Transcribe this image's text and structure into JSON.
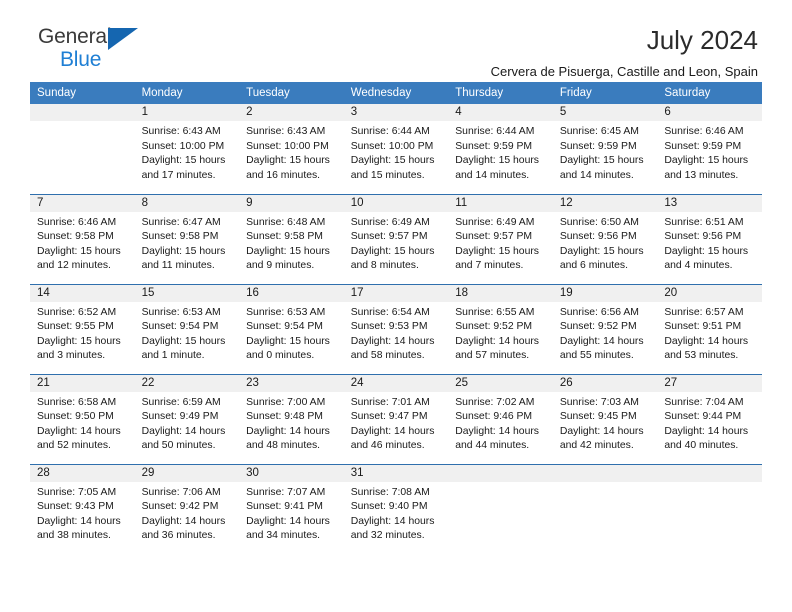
{
  "logo": {
    "word_one": "General",
    "word_two": "Blue",
    "accent_color": "#1f7fd4",
    "triangle_color": "#1566b0",
    "triangle_icon": "triangle-icon"
  },
  "header": {
    "title": "July 2024",
    "location": "Cervera de Pisuerga, Castille and Leon, Spain"
  },
  "theme": {
    "header_band": "#3a7cbe",
    "daynum_band": "#f0f0f0",
    "row_divider": "#2f6fad"
  },
  "weekdays": [
    "Sunday",
    "Monday",
    "Tuesday",
    "Wednesday",
    "Thursday",
    "Friday",
    "Saturday"
  ],
  "weeks": [
    [
      {
        "day": "",
        "sunrise": "",
        "sunset": "",
        "daylight_a": "",
        "daylight_b": ""
      },
      {
        "day": "1",
        "sunrise": "Sunrise: 6:43 AM",
        "sunset": "Sunset: 10:00 PM",
        "daylight_a": "Daylight: 15 hours",
        "daylight_b": "and 17 minutes."
      },
      {
        "day": "2",
        "sunrise": "Sunrise: 6:43 AM",
        "sunset": "Sunset: 10:00 PM",
        "daylight_a": "Daylight: 15 hours",
        "daylight_b": "and 16 minutes."
      },
      {
        "day": "3",
        "sunrise": "Sunrise: 6:44 AM",
        "sunset": "Sunset: 10:00 PM",
        "daylight_a": "Daylight: 15 hours",
        "daylight_b": "and 15 minutes."
      },
      {
        "day": "4",
        "sunrise": "Sunrise: 6:44 AM",
        "sunset": "Sunset: 9:59 PM",
        "daylight_a": "Daylight: 15 hours",
        "daylight_b": "and 14 minutes."
      },
      {
        "day": "5",
        "sunrise": "Sunrise: 6:45 AM",
        "sunset": "Sunset: 9:59 PM",
        "daylight_a": "Daylight: 15 hours",
        "daylight_b": "and 14 minutes."
      },
      {
        "day": "6",
        "sunrise": "Sunrise: 6:46 AM",
        "sunset": "Sunset: 9:59 PM",
        "daylight_a": "Daylight: 15 hours",
        "daylight_b": "and 13 minutes."
      }
    ],
    [
      {
        "day": "7",
        "sunrise": "Sunrise: 6:46 AM",
        "sunset": "Sunset: 9:58 PM",
        "daylight_a": "Daylight: 15 hours",
        "daylight_b": "and 12 minutes."
      },
      {
        "day": "8",
        "sunrise": "Sunrise: 6:47 AM",
        "sunset": "Sunset: 9:58 PM",
        "daylight_a": "Daylight: 15 hours",
        "daylight_b": "and 11 minutes."
      },
      {
        "day": "9",
        "sunrise": "Sunrise: 6:48 AM",
        "sunset": "Sunset: 9:58 PM",
        "daylight_a": "Daylight: 15 hours",
        "daylight_b": "and 9 minutes."
      },
      {
        "day": "10",
        "sunrise": "Sunrise: 6:49 AM",
        "sunset": "Sunset: 9:57 PM",
        "daylight_a": "Daylight: 15 hours",
        "daylight_b": "and 8 minutes."
      },
      {
        "day": "11",
        "sunrise": "Sunrise: 6:49 AM",
        "sunset": "Sunset: 9:57 PM",
        "daylight_a": "Daylight: 15 hours",
        "daylight_b": "and 7 minutes."
      },
      {
        "day": "12",
        "sunrise": "Sunrise: 6:50 AM",
        "sunset": "Sunset: 9:56 PM",
        "daylight_a": "Daylight: 15 hours",
        "daylight_b": "and 6 minutes."
      },
      {
        "day": "13",
        "sunrise": "Sunrise: 6:51 AM",
        "sunset": "Sunset: 9:56 PM",
        "daylight_a": "Daylight: 15 hours",
        "daylight_b": "and 4 minutes."
      }
    ],
    [
      {
        "day": "14",
        "sunrise": "Sunrise: 6:52 AM",
        "sunset": "Sunset: 9:55 PM",
        "daylight_a": "Daylight: 15 hours",
        "daylight_b": "and 3 minutes."
      },
      {
        "day": "15",
        "sunrise": "Sunrise: 6:53 AM",
        "sunset": "Sunset: 9:54 PM",
        "daylight_a": "Daylight: 15 hours",
        "daylight_b": "and 1 minute."
      },
      {
        "day": "16",
        "sunrise": "Sunrise: 6:53 AM",
        "sunset": "Sunset: 9:54 PM",
        "daylight_a": "Daylight: 15 hours",
        "daylight_b": "and 0 minutes."
      },
      {
        "day": "17",
        "sunrise": "Sunrise: 6:54 AM",
        "sunset": "Sunset: 9:53 PM",
        "daylight_a": "Daylight: 14 hours",
        "daylight_b": "and 58 minutes."
      },
      {
        "day": "18",
        "sunrise": "Sunrise: 6:55 AM",
        "sunset": "Sunset: 9:52 PM",
        "daylight_a": "Daylight: 14 hours",
        "daylight_b": "and 57 minutes."
      },
      {
        "day": "19",
        "sunrise": "Sunrise: 6:56 AM",
        "sunset": "Sunset: 9:52 PM",
        "daylight_a": "Daylight: 14 hours",
        "daylight_b": "and 55 minutes."
      },
      {
        "day": "20",
        "sunrise": "Sunrise: 6:57 AM",
        "sunset": "Sunset: 9:51 PM",
        "daylight_a": "Daylight: 14 hours",
        "daylight_b": "and 53 minutes."
      }
    ],
    [
      {
        "day": "21",
        "sunrise": "Sunrise: 6:58 AM",
        "sunset": "Sunset: 9:50 PM",
        "daylight_a": "Daylight: 14 hours",
        "daylight_b": "and 52 minutes."
      },
      {
        "day": "22",
        "sunrise": "Sunrise: 6:59 AM",
        "sunset": "Sunset: 9:49 PM",
        "daylight_a": "Daylight: 14 hours",
        "daylight_b": "and 50 minutes."
      },
      {
        "day": "23",
        "sunrise": "Sunrise: 7:00 AM",
        "sunset": "Sunset: 9:48 PM",
        "daylight_a": "Daylight: 14 hours",
        "daylight_b": "and 48 minutes."
      },
      {
        "day": "24",
        "sunrise": "Sunrise: 7:01 AM",
        "sunset": "Sunset: 9:47 PM",
        "daylight_a": "Daylight: 14 hours",
        "daylight_b": "and 46 minutes."
      },
      {
        "day": "25",
        "sunrise": "Sunrise: 7:02 AM",
        "sunset": "Sunset: 9:46 PM",
        "daylight_a": "Daylight: 14 hours",
        "daylight_b": "and 44 minutes."
      },
      {
        "day": "26",
        "sunrise": "Sunrise: 7:03 AM",
        "sunset": "Sunset: 9:45 PM",
        "daylight_a": "Daylight: 14 hours",
        "daylight_b": "and 42 minutes."
      },
      {
        "day": "27",
        "sunrise": "Sunrise: 7:04 AM",
        "sunset": "Sunset: 9:44 PM",
        "daylight_a": "Daylight: 14 hours",
        "daylight_b": "and 40 minutes."
      }
    ],
    [
      {
        "day": "28",
        "sunrise": "Sunrise: 7:05 AM",
        "sunset": "Sunset: 9:43 PM",
        "daylight_a": "Daylight: 14 hours",
        "daylight_b": "and 38 minutes."
      },
      {
        "day": "29",
        "sunrise": "Sunrise: 7:06 AM",
        "sunset": "Sunset: 9:42 PM",
        "daylight_a": "Daylight: 14 hours",
        "daylight_b": "and 36 minutes."
      },
      {
        "day": "30",
        "sunrise": "Sunrise: 7:07 AM",
        "sunset": "Sunset: 9:41 PM",
        "daylight_a": "Daylight: 14 hours",
        "daylight_b": "and 34 minutes."
      },
      {
        "day": "31",
        "sunrise": "Sunrise: 7:08 AM",
        "sunset": "Sunset: 9:40 PM",
        "daylight_a": "Daylight: 14 hours",
        "daylight_b": "and 32 minutes."
      },
      {
        "day": "",
        "sunrise": "",
        "sunset": "",
        "daylight_a": "",
        "daylight_b": ""
      },
      {
        "day": "",
        "sunrise": "",
        "sunset": "",
        "daylight_a": "",
        "daylight_b": ""
      },
      {
        "day": "",
        "sunrise": "",
        "sunset": "",
        "daylight_a": "",
        "daylight_b": ""
      }
    ]
  ]
}
